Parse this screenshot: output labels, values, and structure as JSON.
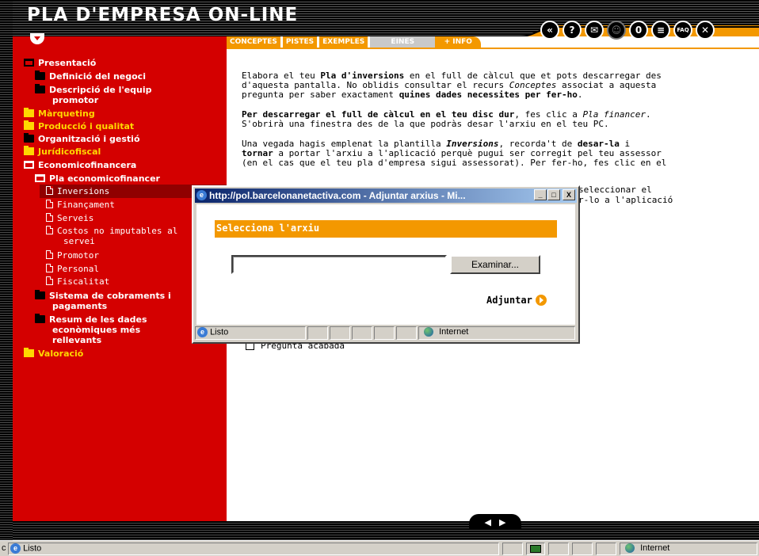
{
  "app": {
    "title": "PLA D'EMPRESA ON-LINE"
  },
  "toolbar": {
    "icons": [
      "back-icon",
      "help-icon",
      "mail-icon",
      "user-icon",
      "attach-icon",
      "notes-icon",
      "faq-icon",
      "close-icon"
    ],
    "faq_label": "FAQ",
    "help_glyph": "?",
    "close_glyph": "✕"
  },
  "tabs": {
    "conceptes": "CONCEPTES",
    "pistes": "PISTES",
    "exemples": "EXEMPLES",
    "eines": "EINES",
    "info": "+ INFO"
  },
  "sidebar": {
    "presentacio": "Presentació",
    "definicio": "Definició del negoci",
    "descripcio_1": "Descripció de l'equip",
    "descripcio_2": "promotor",
    "marqueting": "Màrqueting",
    "produccio": "Producció i qualitat",
    "organitzacio": "Organització i gestió",
    "juridicofiscal": "Jurídicofiscal",
    "economicofinancera": "Economicofinancera",
    "pla_economicofinancer": "Pla economicofinancer",
    "inversions": "Inversions",
    "financament": "Finançament",
    "serveis": "Serveis",
    "costos_1": "Costos no imputables al",
    "costos_2": "servei",
    "promotor": "Promotor",
    "personal": "Personal",
    "fiscalitat": "Fiscalitat",
    "sistema_1": "Sistema de cobraments i",
    "sistema_2": "pagaments",
    "resum_1": "Resum de les dades",
    "resum_2": "econòmiques més",
    "resum_3": "rellevants",
    "valoracio": "Valoració"
  },
  "content": {
    "p1_a": "Elabora el teu ",
    "p1_b": "Pla d'inversions",
    "p1_c": " en el full de càlcul que et pots descarregar des\nd'aquesta pantalla. No oblidis consultar el recurs ",
    "p1_d": "Conceptes",
    "p1_e": " associat a aquesta\npregunta per saber exactament ",
    "p1_f": "quines dades necessites per fer-ho",
    "p1_g": ".",
    "p2_a": "Per descarregar el full de càlcul en el teu disc dur",
    "p2_b": ", fes clic a ",
    "p2_c": "Pla financer",
    "p2_d": ".\nS'obrirà una finestra des de la que podràs desar l'arxiu en el teu PC.",
    "p3_a": "Una vegada hagis emplenat la plantilla ",
    "p3_b": "Inversions",
    "p3_c": ", recorda't de ",
    "p3_d": "desar-la",
    "p3_e": " i\n",
    "p3_f": "tornar",
    "p3_g": " a portar l'arxiu a l'aplicació perquè pugui ser corregit pel teu assessor\n(en el cas que el teu pla d'empresa sigui assessorat). Per fer-ho, fes clic en el",
    "p3_h_visible_1": "seleccionar el",
    "p3_h_visible_2": "r-lo a l'aplicació",
    "checkbox_label": "Pregunta acabada"
  },
  "bottom_nav": {
    "prev": "◀",
    "next": "▶"
  },
  "popup": {
    "title": "http://pol.barcelonanetactiva.com - Adjuntar arxius - Mi...",
    "heading": "Selecciona l'arxiu",
    "file_value": "",
    "browse_label": "Examinar...",
    "attach_label": "Adjuntar",
    "status_text": "Listo",
    "zone_text": "Internet",
    "btn_min": "_",
    "btn_max": "□",
    "btn_close": "X"
  },
  "statusbar": {
    "text": "Listo",
    "zone": "Internet",
    "left_fragment": "c"
  },
  "colors": {
    "sidebar": "#d40000",
    "accent": "#f39800",
    "nav_yellow": "#ffd800",
    "titlebar": "#0a246a"
  }
}
